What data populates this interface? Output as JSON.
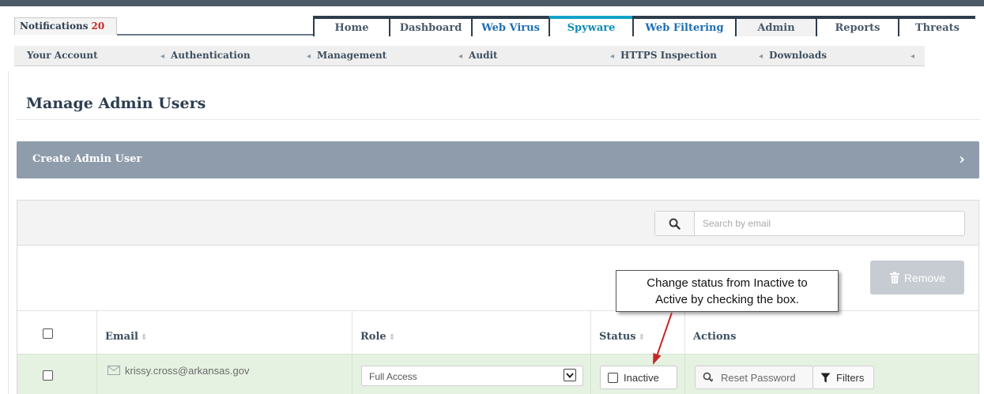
{
  "notifications": {
    "label": "Notifications",
    "count": "20"
  },
  "main_tabs": [
    {
      "label": "Home"
    },
    {
      "label": "Dashboard"
    },
    {
      "label": "Web Virus"
    },
    {
      "label": "Spyware"
    },
    {
      "label": "Web Filtering"
    },
    {
      "label": "Admin"
    },
    {
      "label": "Reports"
    },
    {
      "label": "Threats"
    }
  ],
  "sub_nav": [
    {
      "label": "Your Account"
    },
    {
      "label": "Authentication"
    },
    {
      "label": "Management"
    },
    {
      "label": "Audit"
    },
    {
      "label": "HTTPS Inspection"
    },
    {
      "label": "Downloads"
    }
  ],
  "page": {
    "title": "Manage Admin Users"
  },
  "create_bar": {
    "label": "Create Admin User"
  },
  "search": {
    "placeholder": "Search by email"
  },
  "toolbar": {
    "remove_label": "Remove"
  },
  "table": {
    "headers": {
      "email": "Email",
      "role": "Role",
      "status": "Status",
      "actions": "Actions"
    },
    "rows": [
      {
        "email": "krissy.cross@arkansas.gov",
        "role": "Full Access",
        "status": "Inactive",
        "reset_label": "Reset Password",
        "filters_label": "Filters"
      }
    ]
  },
  "callout": {
    "line1": "Change status from Inactive to",
    "line2": "Active by checking the box."
  },
  "colors": {
    "nav_dark": "#4d5a68",
    "create_bar": "#8f9cac",
    "row_highlight": "#e6f2e1",
    "notification_count": "#c62828"
  }
}
